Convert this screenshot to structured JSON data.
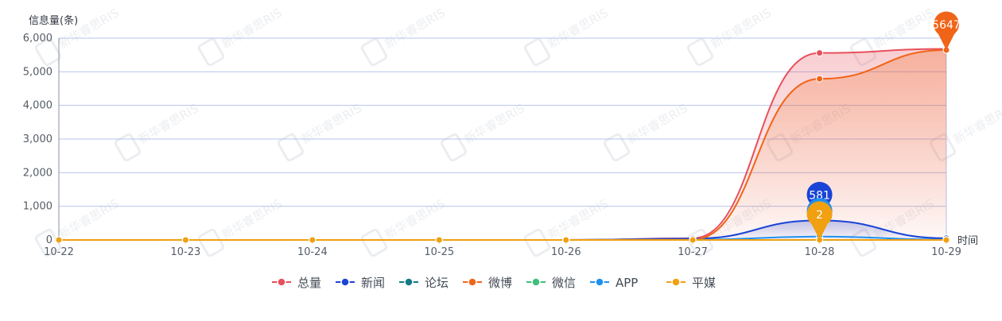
{
  "chart_data": {
    "type": "line",
    "ylabel": "信息量(条)",
    "xlabel": "时间",
    "categories": [
      "10-22",
      "10-23",
      "10-24",
      "10-25",
      "10-26",
      "10-27",
      "10-28",
      "10-29"
    ],
    "ylim": [
      0,
      6000
    ],
    "yticks": [
      0,
      1000,
      2000,
      3000,
      4000,
      5000,
      6000
    ],
    "ytick_labels": [
      "0",
      "1,000",
      "2,000",
      "3,000",
      "4,000",
      "5,000",
      "6,000"
    ],
    "grid": true,
    "legend_position": "bottom",
    "smooth": true,
    "series": [
      {
        "name": "总量",
        "color": "#e8505b",
        "values": [
          0,
          0,
          0,
          0,
          0,
          50,
          5560,
          5680
        ],
        "area": true
      },
      {
        "name": "新闻",
        "color": "#1a44d6",
        "values": [
          0,
          0,
          0,
          0,
          0,
          40,
          581,
          50
        ],
        "area": true
      },
      {
        "name": "论坛",
        "color": "#127a85",
        "values": [
          0,
          0,
          0,
          0,
          0,
          0,
          0,
          0
        ],
        "area": false
      },
      {
        "name": "微博",
        "color": "#f06418",
        "values": [
          0,
          0,
          0,
          0,
          0,
          10,
          4790,
          5647
        ],
        "area": true
      },
      {
        "name": "微信",
        "color": "#3cbf7a",
        "values": [
          0,
          0,
          0,
          0,
          0,
          0,
          0,
          0
        ],
        "area": false
      },
      {
        "name": "APP",
        "color": "#1e90f0",
        "values": [
          0,
          0,
          0,
          0,
          0,
          5,
          100,
          10
        ],
        "area": false
      },
      {
        "name": "平媒",
        "color": "#f0a010",
        "values": [
          0,
          0,
          0,
          0,
          0,
          0,
          2,
          0
        ],
        "area": false
      }
    ],
    "annotations": [
      {
        "series": "微博",
        "category": "10-29",
        "label": "5647",
        "color": "#f06418"
      },
      {
        "series": "新闻",
        "category": "10-28",
        "label": "581",
        "color": "#1a44d6"
      },
      {
        "series": "APP",
        "category": "10-28",
        "label": "",
        "color": "#1e90f0"
      },
      {
        "series": "平媒",
        "category": "10-28",
        "label": "2",
        "color": "#f0a010"
      }
    ]
  },
  "watermark": {
    "text": "新华睿思RIS"
  }
}
